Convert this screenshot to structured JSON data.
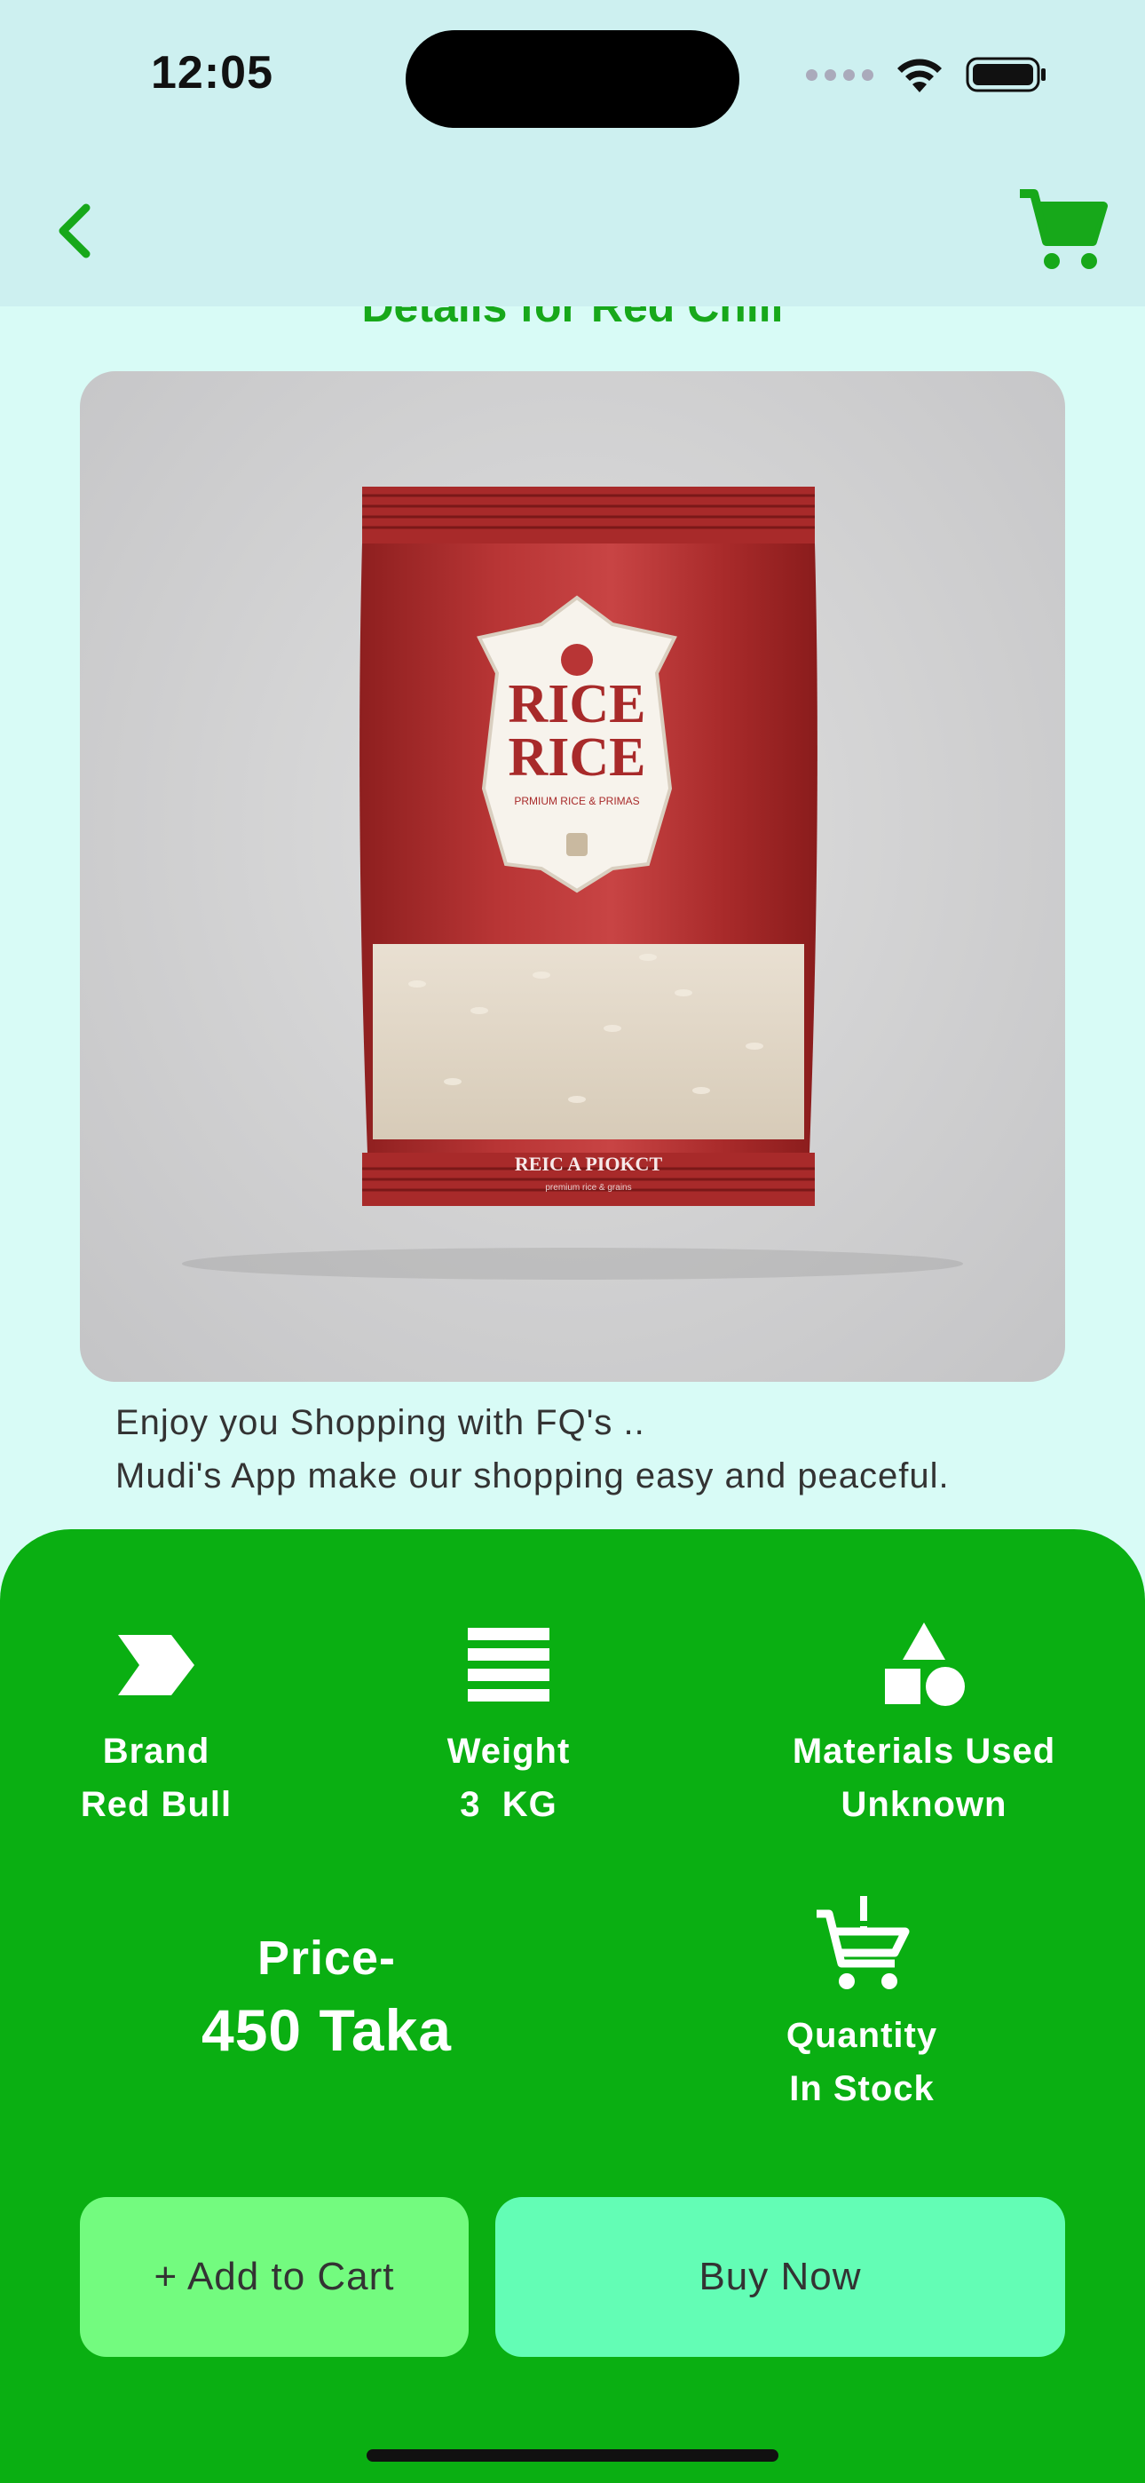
{
  "status_bar": {
    "time": "12:05"
  },
  "header": {
    "back_icon": "chevron-left-icon",
    "cart_icon": "shopping-cart-icon",
    "accent_color": "#17a81a"
  },
  "page_title": "Details for Red Chili",
  "product_image": {
    "label_line1": "RICE",
    "label_line2": "RICE",
    "label_small": "PRMIUM RICE & PRIMAS",
    "bottom_text": "REIC A PIOKCT",
    "bottom_small": "premium rice & grains"
  },
  "description": {
    "line1": "Enjoy you Shopping with FQ's ..",
    "line2": "Mudi's App make our shopping easy and peaceful."
  },
  "specs": {
    "brand": {
      "label": "Brand",
      "value": "Red Bull",
      "icon": "brand-tag-icon"
    },
    "weight": {
      "label": "Weight",
      "value": "3  KG",
      "icon": "weight-lines-icon"
    },
    "materials": {
      "label": "Materials Used",
      "value": "Unknown",
      "icon": "shapes-icon"
    }
  },
  "price": {
    "label": "Price-",
    "value": "450 Taka"
  },
  "quantity": {
    "label": "Quantity",
    "value": "In Stock",
    "icon": "cart-alert-icon"
  },
  "buttons": {
    "add_to_cart": "+ Add to Cart",
    "buy_now": "Buy Now"
  },
  "colors": {
    "panel": "#0aaf12",
    "add_button": "#73fb7f",
    "buy_button": "#63fdb5",
    "background": "#d8fbf6"
  }
}
